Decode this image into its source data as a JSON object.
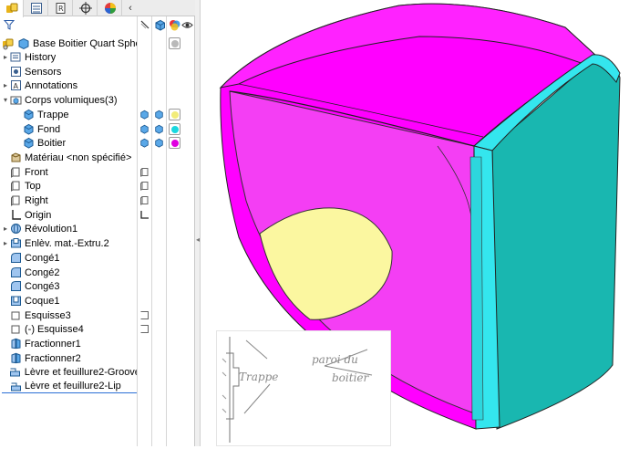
{
  "tabs": [
    {
      "name": "feature-manager",
      "icon": "feature-tree-icon",
      "active": true
    },
    {
      "name": "property-manager",
      "icon": "property-list-icon"
    },
    {
      "name": "configuration-manager",
      "icon": "configuration-icon"
    },
    {
      "name": "dimxpert-manager",
      "icon": "crosshair-icon"
    },
    {
      "name": "display-manager",
      "icon": "appearance-pie-icon"
    }
  ],
  "collapse_glyph": "‹",
  "tree": {
    "root": "Base Boitier Quart Sphère (",
    "items": [
      {
        "label": "History",
        "icon": "history-folder-icon",
        "expander": "▸"
      },
      {
        "label": "Sensors",
        "icon": "sensor-icon",
        "expander": ""
      },
      {
        "label": "Annotations",
        "icon": "annotations-icon",
        "expander": "▸"
      },
      {
        "label": "Corps volumiques(3)",
        "icon": "solid-bodies-folder-icon",
        "expander": "▾"
      },
      {
        "label": "Trappe",
        "icon": "solid-body-icon",
        "expander": "",
        "indent": true
      },
      {
        "label": "Fond",
        "icon": "solid-body-icon",
        "expander": "",
        "indent": true
      },
      {
        "label": "Boitier",
        "icon": "solid-body-icon",
        "expander": "",
        "indent": true
      },
      {
        "label": "Matériau <non spécifié>",
        "icon": "material-icon",
        "expander": ""
      },
      {
        "label": "Front",
        "icon": "plane-icon",
        "expander": ""
      },
      {
        "label": "Top",
        "icon": "plane-icon",
        "expander": ""
      },
      {
        "label": "Right",
        "icon": "plane-icon",
        "expander": ""
      },
      {
        "label": "Origin",
        "icon": "origin-icon",
        "expander": ""
      },
      {
        "label": "Révolution1",
        "icon": "revolve-icon",
        "expander": "▸"
      },
      {
        "label": "Enlèv. mat.-Extru.2",
        "icon": "cut-extrude-icon",
        "expander": "▸"
      },
      {
        "label": "Congé1",
        "icon": "fillet-icon",
        "expander": ""
      },
      {
        "label": "Congé2",
        "icon": "fillet-icon",
        "expander": ""
      },
      {
        "label": "Congé3",
        "icon": "fillet-icon",
        "expander": ""
      },
      {
        "label": "Coque1",
        "icon": "shell-icon",
        "expander": ""
      },
      {
        "label": "Esquisse3",
        "icon": "sketch-icon",
        "expander": ""
      },
      {
        "label": "(-) Esquisse4",
        "icon": "sketch-icon",
        "expander": ""
      },
      {
        "label": "Fractionner1",
        "icon": "split-icon",
        "expander": ""
      },
      {
        "label": "Fractionner2",
        "icon": "split-icon",
        "expander": ""
      },
      {
        "label": "Lèvre et feuillure2-Groove",
        "icon": "lip-groove-icon",
        "expander": ""
      },
      {
        "label": "Lèvre et feuillure2-Lip",
        "icon": "lip-groove-icon",
        "expander": "",
        "selected": true
      }
    ]
  },
  "appearance_colors": {
    "root": "#b9b9b9",
    "Trappe": "#f2ec7a",
    "Fond": "#19d7df",
    "Boitier": "#e000e0"
  },
  "model_colors": {
    "boitier": "#ff00ff",
    "fond": "#19b7b0",
    "fond_edge": "#34e6ee",
    "trappe": "#fbf7a0"
  },
  "sketch_note": {
    "label_left": "Trappe",
    "label_right_line1": "paroi du",
    "label_right_line2": "boitier"
  }
}
